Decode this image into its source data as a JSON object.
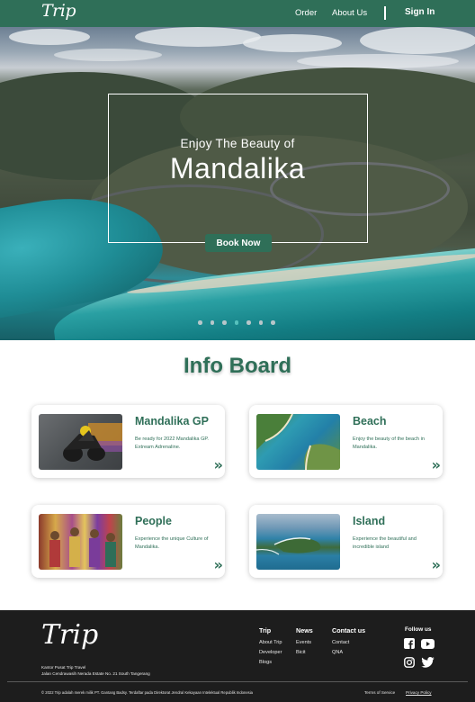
{
  "nav": {
    "logo": "Trip",
    "links": [
      "Order",
      "About Us"
    ],
    "sign_in": "Sign In"
  },
  "hero": {
    "subtitle": "Enjoy The Beauty of",
    "title": "Mandalika",
    "cta": "Book Now",
    "slides_total": 7,
    "active_slide_index": 3
  },
  "info_board": {
    "title": "Info Board",
    "cards": [
      {
        "title": "Mandalika GP",
        "desc": "Be ready for 2022 Mandalika GP. Extream Adrenaline.",
        "image": "motorcycle-racer-image",
        "arrow": "»"
      },
      {
        "title": "Beach",
        "desc": "Enjoy the beauty of the beach in Mandalika.",
        "image": "beach-aerial-image",
        "arrow": "»"
      },
      {
        "title": "People",
        "desc": "Experience the unique Culture of Mandalika.",
        "image": "people-culture-image",
        "arrow": "»"
      },
      {
        "title": "Island",
        "desc": "Experience the beautiful and incredible island",
        "image": "island-aerial-image",
        "arrow": "»"
      }
    ]
  },
  "footer": {
    "logo": "Trip",
    "address_line1": "Kantor Pusat Trip Travel",
    "address_line2": "Jalan Cendrawasih Nerada Estate No. 21 South Tangerang",
    "columns": [
      {
        "heading": "Trip",
        "links": [
          "About Trip",
          "Developer",
          "Blogs"
        ]
      },
      {
        "heading": "News",
        "links": [
          "Events",
          "Bicit"
        ]
      },
      {
        "heading": "Contact us",
        "links": [
          "Contact",
          "QNA"
        ]
      }
    ],
    "follow_us": "Follow us",
    "social_icons": [
      "facebook-icon",
      "youtube-icon",
      "instagram-icon",
      "twitter-icon"
    ],
    "copyright": "© 2022 Trip adalah merek milik PT. Gantang Badsy. Terdaftar pada Direktorat Jendral Kekayaan Intelektual Republik Indonesia",
    "terms": "Terms of Service",
    "privacy": "Privacy Policy"
  },
  "colors": {
    "brand_green": "#2f6f58",
    "footer_bg": "#1d1d1d",
    "active_dot": "#5ec8c2"
  }
}
